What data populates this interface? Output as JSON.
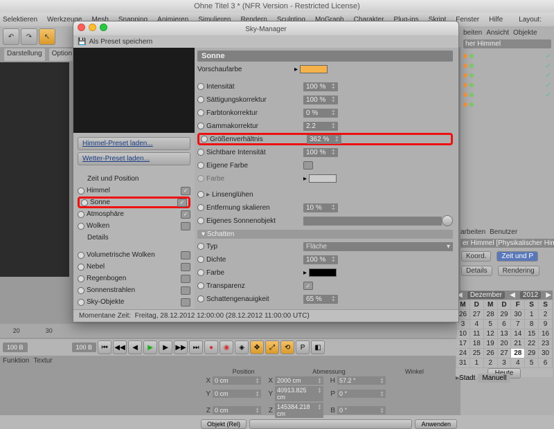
{
  "window_title": "Ohne Titel 3 * (NFR Version - Restricted License)",
  "menubar": [
    "Selektieren",
    "Werkzeuge",
    "Mesh",
    "Snapping",
    "Animieren",
    "Simulieren",
    "Rendern",
    "Sculpting",
    "MoGraph",
    "Charakter",
    "Plug-ins",
    "Skript",
    "Fenster",
    "Hilfe"
  ],
  "layout_label": "Layout:",
  "view_tabs": [
    "Darstellung",
    "Option"
  ],
  "right_tabs_top": [
    "beiten",
    "Ansicht",
    "Objekte"
  ],
  "right_preset": "her Himmel",
  "attr_tabs": [
    "arbeiten",
    "Benutzer"
  ],
  "attr_title": "er Himmel [Physikalischer Himmel]",
  "attr_btns": [
    "Koord.",
    "Zeit und P",
    "Details",
    "Rendering"
  ],
  "cal": {
    "month": "Dezember",
    "year": "2012",
    "days": [
      "M",
      "D",
      "M",
      "D",
      "F",
      "S",
      "S"
    ],
    "rows": [
      [
        "26",
        "27",
        "28",
        "29",
        "30",
        "1",
        "2"
      ],
      [
        "3",
        "4",
        "5",
        "6",
        "7",
        "8",
        "9"
      ],
      [
        "10",
        "11",
        "12",
        "13",
        "14",
        "15",
        "16"
      ],
      [
        "17",
        "18",
        "19",
        "20",
        "21",
        "22",
        "23"
      ],
      [
        "24",
        "25",
        "26",
        "27",
        "28",
        "29",
        "30"
      ],
      [
        "31",
        "1",
        "2",
        "3",
        "4",
        "5",
        "6"
      ]
    ],
    "today": "28",
    "heute": "Heute"
  },
  "stadt_label": "Stadt",
  "stadt_value": "Manuell",
  "timeline_ticks": [
    "20",
    "30"
  ],
  "frame_fields": [
    "100 B",
    "100 B"
  ],
  "bottom_tabs": [
    "Funktion",
    "Textur"
  ],
  "coords": {
    "headers": [
      "Position",
      "Abmessung",
      "Winkel"
    ],
    "rows": [
      {
        "ax": "X",
        "p": "0 cm",
        "a": "2000 cm",
        "wl": "H",
        "w": "57.2 °"
      },
      {
        "ax": "Y",
        "p": "0 cm",
        "a": "40913.825 cm",
        "wl": "P",
        "w": "0 °"
      },
      {
        "ax": "Z",
        "p": "0 cm",
        "a": "145384.218 cm",
        "wl": "B",
        "w": "0 °"
      }
    ],
    "mode": "Objekt (Rel)",
    "apply": "Anwenden"
  },
  "dialog": {
    "title": "Sky-Manager",
    "save_preset": "Als Preset speichern",
    "preset_btns": [
      "Himmel-Preset laden...",
      "Wetter-Preset laden..."
    ],
    "side_groups": {
      "a": [
        {
          "label": "Zeit und Position",
          "plain": true
        },
        {
          "label": "Himmel",
          "check": true
        },
        {
          "label": "Sonne",
          "check": true,
          "hl": true
        },
        {
          "label": "Atmosphäre",
          "check": true
        },
        {
          "label": "Wolken",
          "check": false
        },
        {
          "label": "Details",
          "plain": true
        }
      ],
      "b": [
        {
          "label": "Volumetrische Wolken",
          "check": false
        },
        {
          "label": "Nebel",
          "check": false
        },
        {
          "label": "Regenbogen",
          "check": false
        },
        {
          "label": "Sonnenstrahlen",
          "check": false
        },
        {
          "label": "Sky-Objekte",
          "check": false
        }
      ]
    },
    "section": "Sonne",
    "rows": {
      "preview": "Vorschaufarbe",
      "intensity": {
        "l": "Intensität",
        "v": "100 %"
      },
      "saturation": {
        "l": "Sättigungskorrektur",
        "v": "100 %"
      },
      "hue": {
        "l": "Farbtonkorrektur",
        "v": "0 %"
      },
      "gamma": {
        "l": "Gammakorrektur",
        "v": "2.2"
      },
      "ratio": {
        "l": "Größenverhältnis",
        "v": "362 %",
        "hl": true
      },
      "visint": {
        "l": "Sichtbare Intensität",
        "v": "100 %"
      },
      "owncolor": {
        "l": "Eigene Farbe"
      },
      "color": {
        "l": "Farbe"
      },
      "lensglow": {
        "l": "Linsenglühen"
      },
      "distscale": {
        "l": "Entfernung skalieren",
        "v": "10 %"
      },
      "ownsun": {
        "l": "Eigenes Sonnenobjekt"
      }
    },
    "shadow_hdr": "Schatten",
    "shadow": {
      "type": {
        "l": "Typ",
        "v": "Fläche"
      },
      "density": {
        "l": "Dichte",
        "v": "100 %"
      },
      "color": {
        "l": "Farbe"
      },
      "transp": {
        "l": "Transparenz"
      },
      "accuracy": {
        "l": "Schattengenauigkeit",
        "v": "65 %"
      }
    },
    "status_label": "Momentane Zeit:",
    "status_value": "Freitag, 28.12.2012  12:00:00  (28.12.2012  11:00:00 UTC)"
  }
}
